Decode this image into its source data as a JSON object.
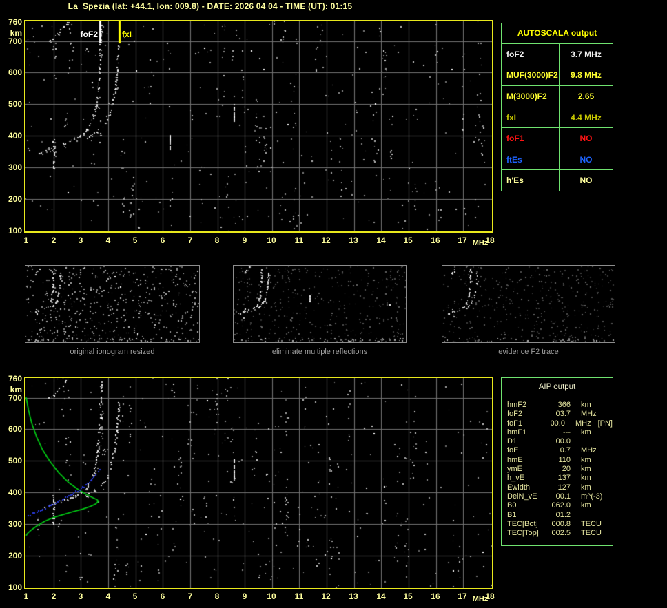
{
  "title": "La_Spezia (lat: +44.1, lon: 009.8) - DATE: 2026 04 04 - TIME (UT): 01:15",
  "colors": {
    "background": "#000000",
    "plot_border_yellow": "#e8e81c",
    "axis_label_yellow": "#ffff9e",
    "grid_gray": "#747474",
    "table_border_green": "#6fe26f",
    "autoscala_header_yellow": "#ffff00",
    "aip_text_khaki": "#e6e6a0",
    "caption_gray": "#9e9e9e",
    "trace_white": "#ffffff",
    "profile_green": "#00cc14",
    "fitted_blue": "#2838d8"
  },
  "thumbnails": [
    {
      "caption": "original ionogram resized"
    },
    {
      "caption": "eliminate multiple reflections"
    },
    {
      "caption": "evidence F2 trace"
    }
  ],
  "autoscala": {
    "title": "AUTOSCALA output",
    "rows": [
      {
        "label": "foF2",
        "value": "3.7 MHz",
        "color": "#f2f2f2"
      },
      {
        "label": "MUF(3000)F2",
        "value": "9.8 MHz",
        "color": "#ffff30"
      },
      {
        "label": "M(3000)F2",
        "value": "2.65",
        "color": "#ffff30"
      },
      {
        "label": "fxI",
        "value": "4.4 MHz",
        "color": "#c8c800"
      },
      {
        "label": "foF1",
        "value": "NO",
        "color": "#ff1414"
      },
      {
        "label": "ftEs",
        "value": "NO",
        "color": "#1e64ff"
      },
      {
        "label": "h'Es",
        "value": "NO",
        "color": "#ffff9c"
      }
    ]
  },
  "aip": {
    "title": "AIP output",
    "rows": [
      {
        "label": "hmF2",
        "value": "366",
        "unit": "km",
        "extra": ""
      },
      {
        "label": "foF2",
        "value": "03.7",
        "unit": "MHz",
        "extra": ""
      },
      {
        "label": "foF1",
        "value": "00.0",
        "unit": "MHz",
        "extra": "[PN]"
      },
      {
        "label": "hmF1",
        "value": "---",
        "unit": "km",
        "extra": ""
      },
      {
        "label": "D1",
        "value": "00.0",
        "unit": "",
        "extra": ""
      },
      {
        "label": "foE",
        "value": "0.7",
        "unit": "MHz",
        "extra": ""
      },
      {
        "label": "hmE",
        "value": "110",
        "unit": "km",
        "extra": ""
      },
      {
        "label": "ymE",
        "value": "20",
        "unit": "km",
        "extra": ""
      },
      {
        "label": "h_vE",
        "value": "137",
        "unit": "km",
        "extra": ""
      },
      {
        "label": "Ewidth",
        "value": "127",
        "unit": "km",
        "extra": ""
      },
      {
        "label": "DelN_vE",
        "value": "00.1",
        "unit": "m^(-3)",
        "extra": ""
      },
      {
        "label": "B0",
        "value": "062.0",
        "unit": "km",
        "extra": ""
      },
      {
        "label": "B1",
        "value": "01.2",
        "unit": "",
        "extra": ""
      },
      {
        "label": "TEC[Bot]",
        "value": "000.8",
        "unit": "TECU",
        "extra": ""
      },
      {
        "label": "TEC[Top]",
        "value": "002.5",
        "unit": "TECU",
        "extra": ""
      }
    ]
  },
  "chart_data": {
    "type": "scatter",
    "panels": [
      "ionogram with autoscaled characteristics",
      "ionogram with electron density profile and fitted trace"
    ],
    "xlabel": "MHz",
    "ylabel": "km",
    "xlim": [
      1,
      18
    ],
    "ylim": [
      100,
      760
    ],
    "x_ticks": [
      1,
      2,
      3,
      4,
      5,
      6,
      7,
      8,
      9,
      10,
      11,
      12,
      13,
      14,
      15,
      16,
      17,
      18
    ],
    "y_ticks": [
      760,
      700,
      600,
      500,
      400,
      300,
      200,
      100
    ],
    "grid": true,
    "series": [
      {
        "name": "F2 O-mode trace",
        "color": "#ffffff",
        "points": [
          [
            1.45,
            342
          ],
          [
            1.62,
            348
          ],
          [
            1.8,
            356
          ],
          [
            2.0,
            366
          ],
          [
            2.25,
            373
          ],
          [
            2.5,
            380
          ],
          [
            2.75,
            389
          ],
          [
            3.0,
            401
          ],
          [
            3.2,
            416
          ],
          [
            3.35,
            436
          ],
          [
            3.47,
            462
          ],
          [
            3.56,
            498
          ],
          [
            3.62,
            542
          ],
          [
            3.66,
            588
          ],
          [
            3.69,
            634
          ],
          [
            3.71,
            678
          ],
          [
            3.73,
            722
          ],
          [
            3.75,
            758
          ]
        ]
      },
      {
        "name": "F2 X-mode trace",
        "color": "#ffffff",
        "points": [
          [
            3.18,
            392
          ],
          [
            3.4,
            402
          ],
          [
            3.62,
            414
          ],
          [
            3.8,
            429
          ],
          [
            3.95,
            449
          ],
          [
            4.07,
            474
          ],
          [
            4.17,
            508
          ],
          [
            4.25,
            550
          ],
          [
            4.31,
            596
          ],
          [
            4.36,
            642
          ],
          [
            4.39,
            682
          ],
          [
            4.41,
            712
          ]
        ]
      },
      {
        "name": "second-hop echo",
        "color": "#ffffff",
        "points": [
          [
            1.85,
            697
          ],
          [
            2.02,
            712
          ],
          [
            2.18,
            726
          ],
          [
            2.33,
            740
          ],
          [
            2.47,
            754
          ],
          [
            2.58,
            764
          ]
        ]
      },
      {
        "name": "vertical trace segment",
        "color": "#ffffff",
        "points": [
          [
            2.0,
            297
          ],
          [
            2.0,
            393
          ]
        ]
      }
    ],
    "interference": [
      {
        "x": 8.62,
        "km": [
          448,
          505
        ]
      },
      {
        "x": 6.28,
        "km": [
          358,
          415
        ]
      }
    ],
    "markers": [
      {
        "name": "foF2",
        "x": 3.7,
        "label": "foF2",
        "color": "#ffffff"
      },
      {
        "name": "fxI",
        "x": 4.4,
        "label": "fxI",
        "color": "#ffff00"
      }
    ],
    "profile": {
      "name": "electron density profile",
      "color": "#00cc14",
      "points": [
        [
          1.0,
          701
        ],
        [
          1.08,
          662
        ],
        [
          1.2,
          620
        ],
        [
          1.38,
          576
        ],
        [
          1.6,
          535
        ],
        [
          1.88,
          497
        ],
        [
          2.2,
          462
        ],
        [
          2.55,
          432
        ],
        [
          2.9,
          410
        ],
        [
          3.2,
          394
        ],
        [
          3.45,
          383
        ],
        [
          3.6,
          377
        ],
        [
          3.64,
          373
        ],
        [
          3.55,
          364
        ],
        [
          3.35,
          356
        ],
        [
          3.05,
          347
        ],
        [
          2.7,
          339
        ],
        [
          2.35,
          330
        ],
        [
          2.0,
          321
        ],
        [
          1.68,
          309
        ],
        [
          1.4,
          295
        ],
        [
          1.18,
          281
        ],
        [
          1.04,
          270
        ],
        [
          1.0,
          264
        ]
      ]
    },
    "fitted": {
      "name": "autoscaled trace fit",
      "color": "#2838d8",
      "points": [
        [
          1.0,
          326
        ],
        [
          1.25,
          334
        ],
        [
          1.5,
          344
        ],
        [
          1.75,
          354
        ],
        [
          2.0,
          364
        ],
        [
          2.25,
          375
        ],
        [
          2.5,
          387
        ],
        [
          2.75,
          400
        ],
        [
          3.0,
          413
        ],
        [
          3.2,
          427
        ],
        [
          3.38,
          442
        ],
        [
          3.52,
          456
        ],
        [
          3.63,
          468
        ],
        [
          3.71,
          479
        ]
      ]
    }
  }
}
